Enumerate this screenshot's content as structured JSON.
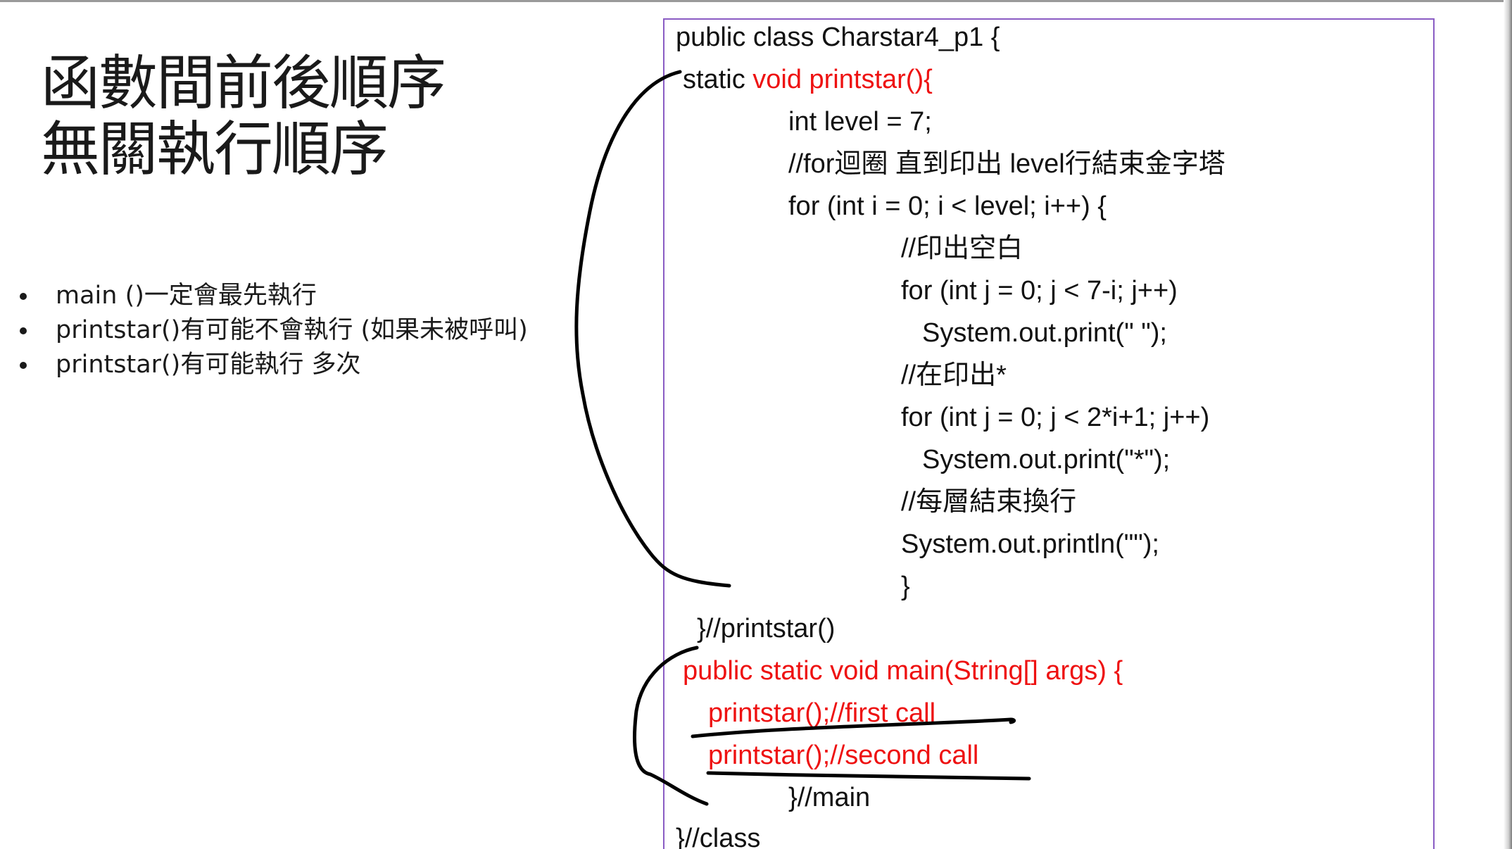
{
  "title": {
    "line1": "函數間前後順序",
    "line2": "無關執行順序"
  },
  "bullets": [
    "main ()一定會最先執行",
    "printstar()有可能不會執行 (如果未被呼叫)",
    "printstar()有可能執行 多次"
  ],
  "code": {
    "l01": "public class Charstar4_p1 {",
    "l02a": "static ",
    "l02b": "void printstar(){",
    "l03": "int level = 7;",
    "l04": "//for迴圈 直到印出 level行結束金字塔",
    "l05": "for (int i = 0; i < level; i++) {",
    "l06": "//印出空白",
    "l07": "for (int j = 0; j < 7-i; j++)",
    "l08": "System.out.print(\" \");",
    "l09": "//在印出*",
    "l10": "for (int j = 0; j < 2*i+1; j++)",
    "l11": "System.out.print(\"*\");",
    "l12": "//每層結束換行",
    "l13": "System.out.println(\"\");",
    "l14": "}",
    "l15": "}//printstar()",
    "l16": "public static void main(String[] args) {",
    "l17": "printstar();//first call",
    "l18": "printstar();//second call",
    "l19": "}//main",
    "l20": "}//class"
  },
  "colors": {
    "keyword_red": "#ee1111",
    "box_border": "#8a5cc4",
    "ink": "#000000"
  }
}
